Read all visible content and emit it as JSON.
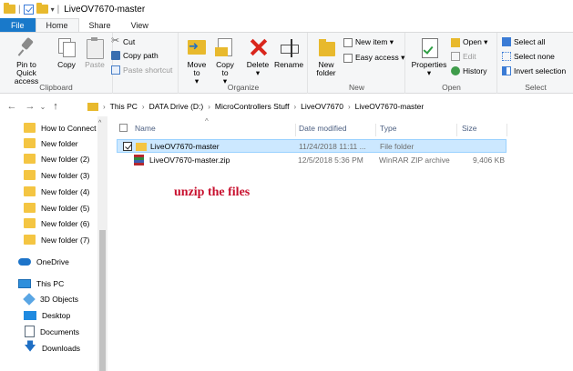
{
  "window": {
    "title": "LiveOV7670-master"
  },
  "tabs": [
    {
      "label": "File"
    },
    {
      "label": "Home"
    },
    {
      "label": "Share"
    },
    {
      "label": "View"
    }
  ],
  "ribbon": {
    "clipboard": {
      "label": "Clipboard",
      "pin": "Pin to Quick access",
      "copy": "Copy",
      "paste": "Paste",
      "cut": "Cut",
      "copy_path": "Copy path",
      "paste_shortcut": "Paste shortcut"
    },
    "organize": {
      "label": "Organize",
      "move_to": "Move to",
      "copy_to": "Copy to",
      "delete": "Delete",
      "rename": "Rename",
      "move_arrow": "▾",
      "copy_arrow": "▾",
      "delete_arrow": "▾"
    },
    "new": {
      "label": "New",
      "new_folder": "New folder",
      "new_item": "New item ▾",
      "easy_access": "Easy access ▾"
    },
    "open": {
      "label": "Open",
      "properties": "Properties",
      "properties_arrow": "▾",
      "open": "Open ▾",
      "edit": "Edit",
      "history": "History"
    },
    "select": {
      "label": "Select",
      "select_all": "Select all",
      "select_none": "Select none",
      "invert": "Invert selection"
    }
  },
  "address": {
    "crumbs": [
      "This PC",
      "DATA Drive (D:)",
      "MicroControllers Stuff",
      "LiveOV7670",
      "LiveOV7670-master"
    ]
  },
  "nav_pane": {
    "folders": [
      "How to Connect",
      "New folder",
      "New folder (2)",
      "New folder (3)",
      "New folder (4)",
      "New folder (5)",
      "New folder (6)",
      "New folder (7)"
    ],
    "onedrive": "OneDrive",
    "this_pc": "This PC",
    "pc_items": [
      "3D Objects",
      "Desktop",
      "Documents",
      "Downloads"
    ]
  },
  "columns": {
    "name": "Name",
    "date": "Date modified",
    "type": "Type",
    "size": "Size"
  },
  "files": [
    {
      "name": "LiveOV7670-master",
      "date": "11/24/2018 11:11 ...",
      "type": "File folder",
      "size": ""
    },
    {
      "name": "LiveOV7670-master.zip",
      "date": "12/5/2018 5:36 PM",
      "type": "WinRAR ZIP archive",
      "size": "9,406 KB"
    }
  ],
  "annotation": "unzip the files"
}
